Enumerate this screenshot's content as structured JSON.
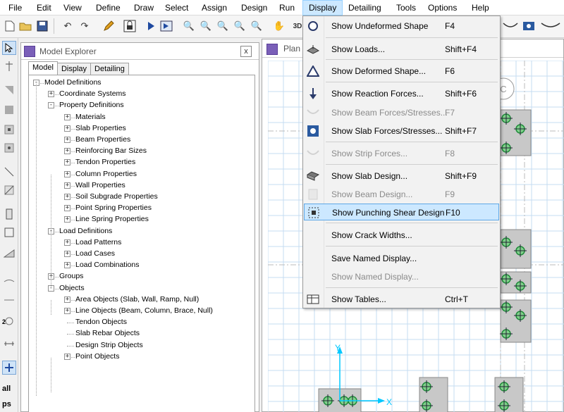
{
  "menubar": {
    "items": [
      "File",
      "Edit",
      "View",
      "Define",
      "Draw",
      "Select",
      "Assign",
      "Design",
      "Run",
      "Display",
      "Detailing",
      "Tools",
      "Options",
      "Help"
    ],
    "active": "Display"
  },
  "toolbar": {
    "icons": [
      "new-file-icon",
      "open-folder-icon",
      "save-icon",
      "undo-icon",
      "redo-icon",
      "pencil-icon",
      "lock-icon",
      "run-icon",
      "run-analyze-icon",
      "zoom-window-icon",
      "zoom-rubber-icon",
      "zoom-in-icon",
      "zoom-out-icon",
      "zoom-previous-icon",
      "pan-icon"
    ],
    "view_3d_label": "3D"
  },
  "left_toolbar": {
    "labels": [
      "all",
      "ps"
    ],
    "dim_label": "2"
  },
  "model_explorer": {
    "title": "Model Explorer",
    "close_label": "x",
    "tabs": [
      "Model",
      "Display",
      "Detailing"
    ],
    "tree": {
      "root": "Model Definitions",
      "coordinate_systems": "Coordinate Systems",
      "property_definitions": {
        "label": "Property Definitions",
        "children": [
          "Materials",
          "Slab Properties",
          "Beam Properties",
          "Reinforcing Bar Sizes",
          "Tendon Properties",
          "Column Properties",
          "Wall Properties",
          "Soil Subgrade Properties",
          "Point Spring Properties",
          "Line Spring Properties"
        ]
      },
      "load_definitions": {
        "label": "Load Definitions",
        "children": [
          "Load Patterns",
          "Load Cases",
          "Load Combinations"
        ]
      },
      "groups": "Groups",
      "objects": {
        "label": "Objects",
        "children": [
          "Area Objects (Slab, Wall, Ramp, Null)",
          "Line Objects (Beam, Column, Brace, Null)",
          "Tendon Objects",
          "Slab Rebar Objects",
          "Design Strip Objects",
          "Point Objects"
        ]
      }
    }
  },
  "plan_window": {
    "title": "Plan",
    "grid_bubble": "C",
    "axis_x": "X",
    "axis_y": "Y"
  },
  "display_menu": {
    "items": [
      {
        "label": "Show Undeformed Shape",
        "shortcut": "F4",
        "icon": "undeformed-shape-icon",
        "enabled": true
      },
      {
        "label": "Show Loads...",
        "shortcut": "Shift+F4",
        "icon": "loads-icon",
        "enabled": true
      },
      {
        "label": "Show Deformed Shape...",
        "shortcut": "F6",
        "icon": "deformed-shape-icon",
        "enabled": true
      },
      {
        "label": "Show Reaction Forces...",
        "shortcut": "Shift+F6",
        "icon": "reaction-forces-icon",
        "enabled": true
      },
      {
        "label": "Show Beam Forces/Stresses...",
        "shortcut": "F7",
        "icon": "beam-forces-icon",
        "enabled": false
      },
      {
        "label": "Show Slab Forces/Stresses...",
        "shortcut": "Shift+F7",
        "icon": "slab-forces-icon",
        "enabled": true
      },
      {
        "label": "Show Strip Forces...",
        "shortcut": "F8",
        "icon": "strip-forces-icon",
        "enabled": false
      },
      {
        "label": "Show Slab Design...",
        "shortcut": "Shift+F9",
        "icon": "slab-design-icon",
        "enabled": true
      },
      {
        "label": "Show Beam Design...",
        "shortcut": "F9",
        "icon": "beam-design-icon",
        "enabled": false
      },
      {
        "label": "Show Punching Shear Design",
        "shortcut": "F10",
        "icon": "punching-shear-icon",
        "enabled": true,
        "highlighted": true
      },
      {
        "label": "Show Crack Widths...",
        "shortcut": "",
        "icon": "",
        "enabled": true
      },
      {
        "label": "Save Named Display...",
        "shortcut": "",
        "icon": "",
        "enabled": true
      },
      {
        "label": "Show Named Display...",
        "shortcut": "",
        "icon": "",
        "enabled": false
      },
      {
        "label": "Show Tables...",
        "shortcut": "Ctrl+T",
        "icon": "tables-icon",
        "enabled": true
      }
    ]
  },
  "colors": {
    "highlight_bg": "#cce8ff",
    "highlight_border": "#5ea7e6",
    "grid_blue": "#c5dcf2",
    "column_green": "#1f8a3a",
    "axis_cyan": "#00c8ff",
    "tree_purple": "#7a5fb8"
  }
}
